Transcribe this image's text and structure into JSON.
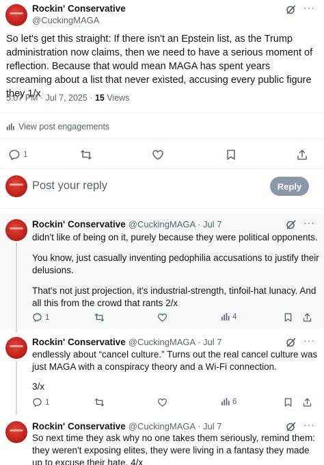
{
  "main_post": {
    "name": "Rockin' Conservative",
    "handle": "@CuckingMAGA",
    "text": "So let's get this straight: If there isn't an Epstein list, as the Trump administration now claims, then we need to have a serious moment of reflection. Because that would mean MAGA has spent years screaming about a list that never existed, accusing every public figure they 1/x",
    "timestamp": "5:07 PM · Jul 7, 2025 · ",
    "views_count": "15",
    "views_label": " Views",
    "engagements_label": "View post engagements",
    "reply_count": "1"
  },
  "composer": {
    "placeholder": "Post your reply",
    "reply_button": "Reply"
  },
  "replies": [
    {
      "name": "Rockin' Conservative",
      "meta": "@CuckingMAGA · Jul 7",
      "paragraphs": [
        "didn't like of being on it, purely because they were political opponents.",
        "You know, just casually inventing pedophilia accusations to justify their delusions.",
        "That's not just projection, it's industrial-strength, tinfoil-hat lunacy. And all this from the crowd that rants 2/x"
      ],
      "reply_count": "1",
      "views": "4"
    },
    {
      "name": "Rockin' Conservative",
      "meta": "@CuckingMAGA · Jul 7",
      "paragraphs": [
        "endlessly about “cancel culture.” Turns out the real cancel culture was just MAGA with a conspiracy theory and a Wi-Fi connection.",
        "3/x"
      ],
      "reply_count": "1",
      "views": "6"
    },
    {
      "name": "Rockin' Conservative",
      "meta": "@CuckingMAGA · Jul 7",
      "paragraphs": [
        "So next time they ask why no one takes them seriously, remind them: they weren't exposing elites, they were living in a fantasy they made up to excuse their hate. 4/x"
      ]
    }
  ],
  "colors": {
    "accent": "#1d9bf0",
    "muted_text": "#536471",
    "reply_button_bg": "#8b98a5"
  }
}
